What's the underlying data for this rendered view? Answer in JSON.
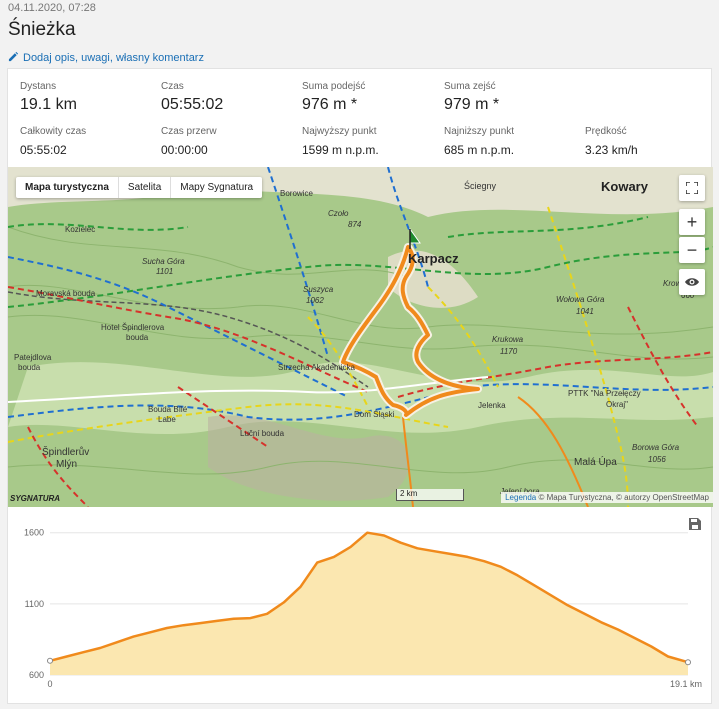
{
  "header": {
    "date": "04.11.2020, 07:28",
    "title": "Śnieżka",
    "edit_link": "Dodaj opis, uwagi, własny komentarz"
  },
  "stats": [
    {
      "label": "Dystans",
      "value": "19.1 km"
    },
    {
      "label": "Czas",
      "value": "05:55:02"
    },
    {
      "label": "Suma podejść",
      "value": "976 m *"
    },
    {
      "label": "Suma zejść",
      "value": "979 m *"
    },
    {
      "label": "Całkowity czas",
      "value": "05:55:02"
    },
    {
      "label": "Czas przerw",
      "value": "00:00:00"
    },
    {
      "label": "Najwyższy punkt",
      "value": "1599 m n.p.m."
    },
    {
      "label": "Najniższy punkt",
      "value": "685 m n.p.m."
    },
    {
      "label": "Prędkość",
      "value": "3.23 km/h"
    }
  ],
  "map": {
    "layers": [
      "Mapa turystyczna",
      "Satelita",
      "Mapy Sygnatura"
    ],
    "active_layer": "Mapa turystyczna",
    "zoom_in": "+",
    "zoom_out": "−",
    "scale": "2 km",
    "attribution_link": "Legenda",
    "attribution": " © Mapa Turystyczna, © autorzy OpenStreetMap",
    "logo": "SYGNATURA",
    "labels": {
      "karpacz": "Karpacz",
      "kowary": "Kowary",
      "sciegny": "Ściegny",
      "kozielec": "Kozielec",
      "sucha_gora": "Sucha Góra",
      "sucha_gora_h": "1101",
      "czolo": "Czoło",
      "czolo_h": "874",
      "suszyca": "Suszyca",
      "suszyca_h": "1062",
      "moravska": "Moravská bouda",
      "hotel": "Hotel Špindlerova",
      "hotel2": "bouda",
      "patejdlova": "Patejdlova",
      "patejdlova2": "bouda",
      "strzecha": "Strzecha Akademicka",
      "dom_slaski": "Dom Śląski",
      "bouda_bile": "Bouda Bílé",
      "labe": "Labe",
      "lucni": "Luční bouda",
      "spindleruv": "Špindlerův",
      "mlyn": "Mlýn",
      "wolowa": "Wołowa Góra",
      "wolowa_h": "1041",
      "krukowa": "Krukowa",
      "krukowa_h": "1170",
      "jelenka": "Jelenka",
      "pttk": "PTTK \"Na Przełęczy",
      "pttk2": "Okraj\"",
      "borowa": "Borowa Góra",
      "borowa_h": "1056",
      "mala_upa": "Malá Úpa",
      "krowiarki": "Krowiarki",
      "krowiarki_h": "660",
      "borowice": "Borowice",
      "jeleni": "Jelení bora"
    }
  },
  "chart_data": {
    "type": "area",
    "title": "",
    "xlabel": "",
    "ylabel": "",
    "x_unit_label": "19.1 km",
    "x_start_label": "0",
    "yticks": [
      600,
      1100,
      1600
    ],
    "ylim": [
      600,
      1640
    ],
    "xlim": [
      0,
      19.1
    ],
    "line_color": "#f08a1c",
    "fill_color": "#fbe7b0",
    "x": [
      0,
      0.5,
      1.0,
      1.5,
      2.0,
      2.5,
      3.0,
      3.5,
      4.0,
      4.5,
      5.0,
      5.5,
      6.0,
      6.5,
      7.0,
      7.5,
      8.0,
      8.5,
      9.0,
      9.5,
      10.0,
      10.5,
      11.0,
      11.5,
      12.0,
      12.5,
      13.0,
      13.5,
      14.0,
      14.5,
      15.0,
      15.5,
      16.0,
      16.5,
      17.0,
      17.5,
      18.0,
      18.5,
      19.1
    ],
    "y": [
      700,
      730,
      760,
      790,
      830,
      870,
      900,
      930,
      950,
      965,
      980,
      995,
      1000,
      1030,
      1110,
      1220,
      1390,
      1430,
      1500,
      1600,
      1580,
      1530,
      1490,
      1470,
      1450,
      1430,
      1400,
      1360,
      1300,
      1230,
      1160,
      1090,
      1030,
      970,
      920,
      860,
      800,
      730,
      690
    ]
  }
}
